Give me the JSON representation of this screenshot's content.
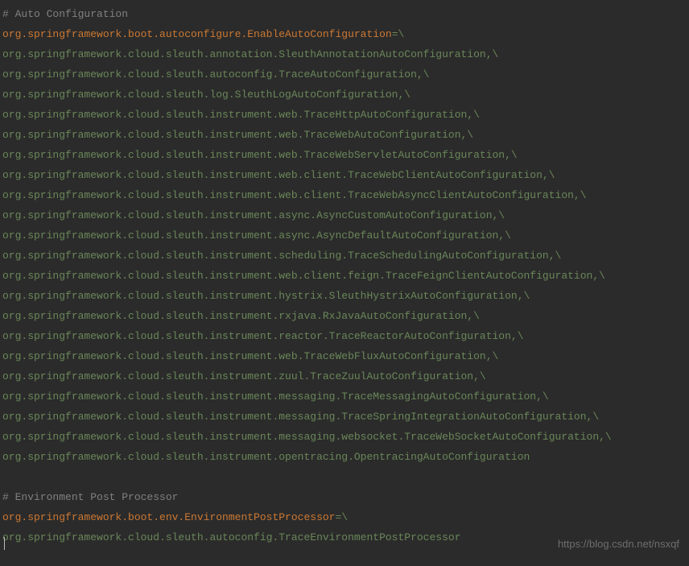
{
  "lines": [
    {
      "type": "comment",
      "text": "# Auto Configuration"
    },
    {
      "type": "keyline",
      "key": "org.springframework.boot.autoconfigure.EnableAutoConfiguration",
      "suffix": "=\\"
    },
    {
      "type": "value",
      "text": "org.springframework.cloud.sleuth.annotation.SleuthAnnotationAutoConfiguration,\\"
    },
    {
      "type": "value",
      "text": "org.springframework.cloud.sleuth.autoconfig.TraceAutoConfiguration,\\"
    },
    {
      "type": "value",
      "text": "org.springframework.cloud.sleuth.log.SleuthLogAutoConfiguration,\\"
    },
    {
      "type": "value",
      "text": "org.springframework.cloud.sleuth.instrument.web.TraceHttpAutoConfiguration,\\"
    },
    {
      "type": "value",
      "text": "org.springframework.cloud.sleuth.instrument.web.TraceWebAutoConfiguration,\\"
    },
    {
      "type": "value",
      "text": "org.springframework.cloud.sleuth.instrument.web.TraceWebServletAutoConfiguration,\\"
    },
    {
      "type": "value",
      "text": "org.springframework.cloud.sleuth.instrument.web.client.TraceWebClientAutoConfiguration,\\"
    },
    {
      "type": "value",
      "text": "org.springframework.cloud.sleuth.instrument.web.client.TraceWebAsyncClientAutoConfiguration,\\"
    },
    {
      "type": "value",
      "text": "org.springframework.cloud.sleuth.instrument.async.AsyncCustomAutoConfiguration,\\"
    },
    {
      "type": "value",
      "text": "org.springframework.cloud.sleuth.instrument.async.AsyncDefaultAutoConfiguration,\\"
    },
    {
      "type": "value",
      "text": "org.springframework.cloud.sleuth.instrument.scheduling.TraceSchedulingAutoConfiguration,\\"
    },
    {
      "type": "value",
      "text": "org.springframework.cloud.sleuth.instrument.web.client.feign.TraceFeignClientAutoConfiguration,\\"
    },
    {
      "type": "value",
      "text": "org.springframework.cloud.sleuth.instrument.hystrix.SleuthHystrixAutoConfiguration,\\"
    },
    {
      "type": "value",
      "text": "org.springframework.cloud.sleuth.instrument.rxjava.RxJavaAutoConfiguration,\\"
    },
    {
      "type": "value",
      "text": "org.springframework.cloud.sleuth.instrument.reactor.TraceReactorAutoConfiguration,\\"
    },
    {
      "type": "value",
      "text": "org.springframework.cloud.sleuth.instrument.web.TraceWebFluxAutoConfiguration,\\"
    },
    {
      "type": "value",
      "text": "org.springframework.cloud.sleuth.instrument.zuul.TraceZuulAutoConfiguration,\\"
    },
    {
      "type": "value",
      "text": "org.springframework.cloud.sleuth.instrument.messaging.TraceMessagingAutoConfiguration,\\"
    },
    {
      "type": "value",
      "text": "org.springframework.cloud.sleuth.instrument.messaging.TraceSpringIntegrationAutoConfiguration,\\"
    },
    {
      "type": "value",
      "text": "org.springframework.cloud.sleuth.instrument.messaging.websocket.TraceWebSocketAutoConfiguration,\\"
    },
    {
      "type": "value",
      "text": "org.springframework.cloud.sleuth.instrument.opentracing.OpentracingAutoConfiguration"
    },
    {
      "type": "blank",
      "text": ""
    },
    {
      "type": "comment",
      "text": "# Environment Post Processor"
    },
    {
      "type": "keyline",
      "key": "org.springframework.boot.env.EnvironmentPostProcessor",
      "suffix": "=\\"
    },
    {
      "type": "value",
      "text": "org.springframework.cloud.sleuth.autoconfig.TraceEnvironmentPostProcessor"
    }
  ],
  "watermark": "https://blog.csdn.net/nsxqf"
}
